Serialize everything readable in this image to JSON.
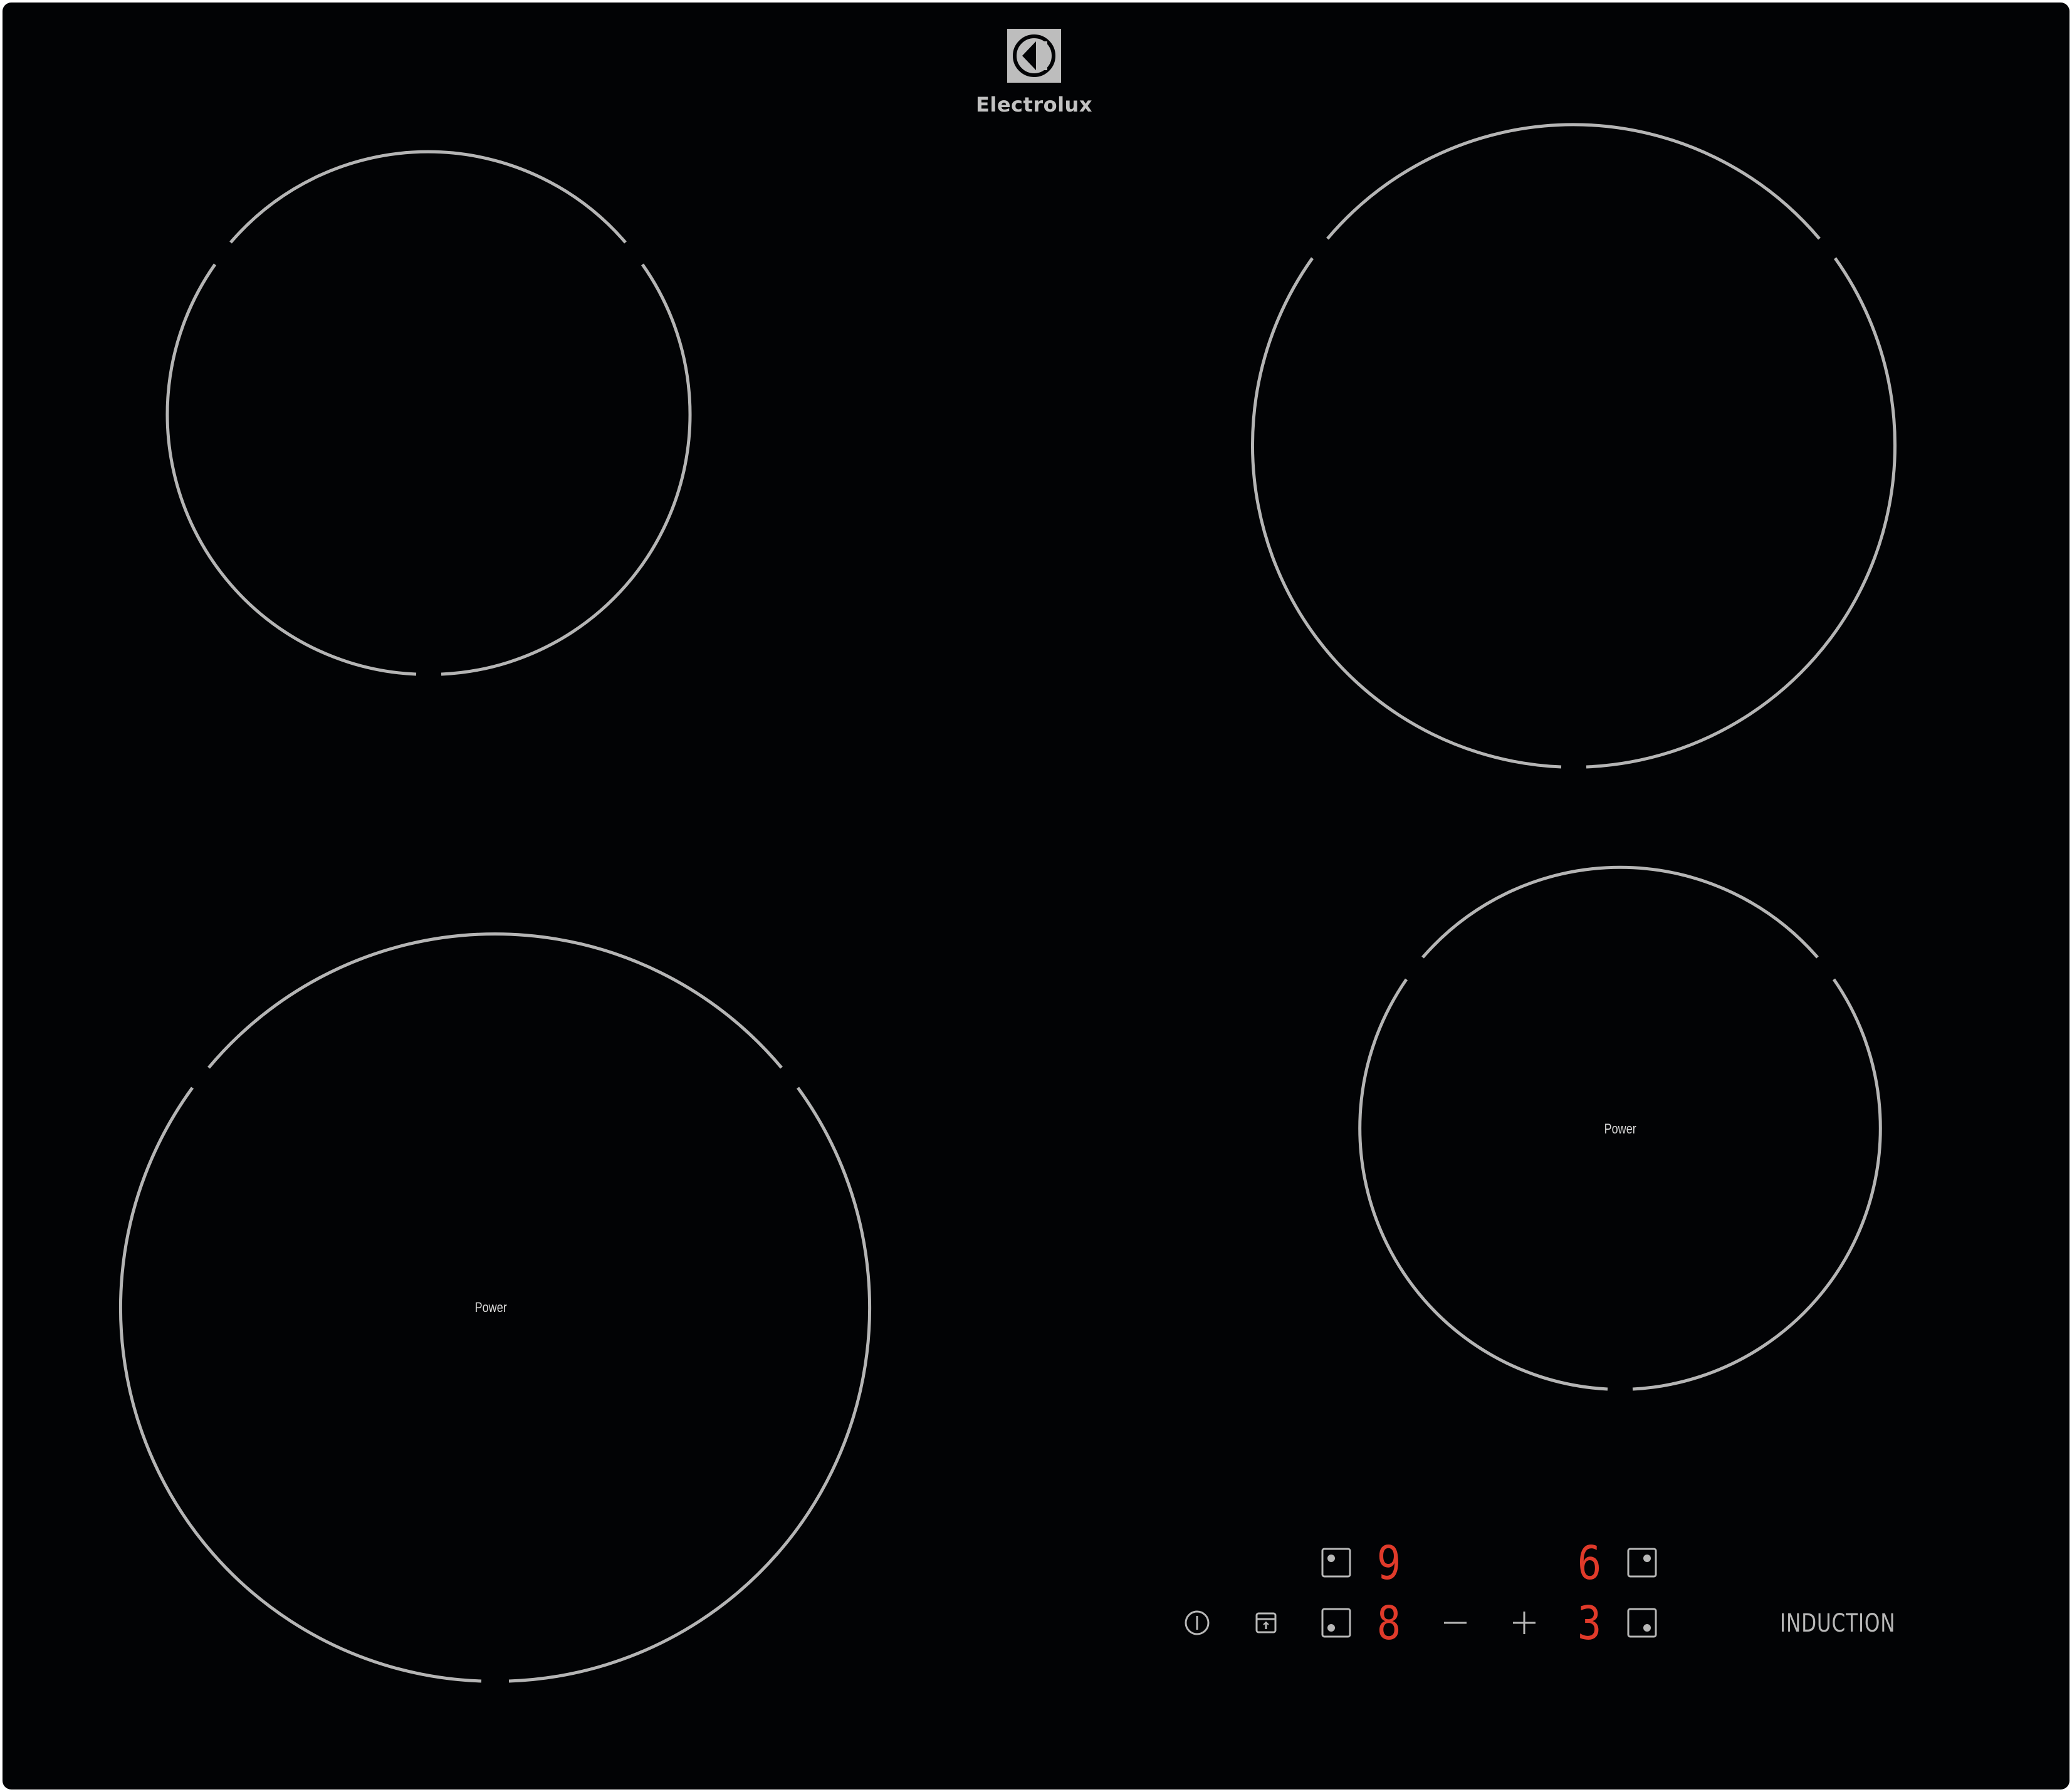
{
  "brand": {
    "name": "Electrolux"
  },
  "cooking_zones": [
    {
      "id": "rear-left",
      "label": ""
    },
    {
      "id": "rear-right",
      "label": ""
    },
    {
      "id": "front-left",
      "label": "Power"
    },
    {
      "id": "front-right",
      "label": "Power"
    }
  ],
  "control_panel": {
    "onoff_icon": "power-icon",
    "lock_icon": "lock-icon",
    "zone_selectors": [
      {
        "icon": "zone-rear-left-selector-icon",
        "display": "9"
      },
      {
        "icon": "zone-rear-right-selector-icon",
        "display": "6"
      },
      {
        "icon": "zone-front-left-selector-icon",
        "display": "8"
      },
      {
        "icon": "zone-front-right-selector-icon",
        "display": "3"
      }
    ],
    "minus_icon": "minus-icon",
    "plus_icon": "plus-icon",
    "technology_label": "INDUCTION"
  },
  "colors": {
    "glass": "#020305",
    "ring": "#b5b5b5",
    "display_led": "#e03a2a",
    "print": "#b8b8b8"
  }
}
